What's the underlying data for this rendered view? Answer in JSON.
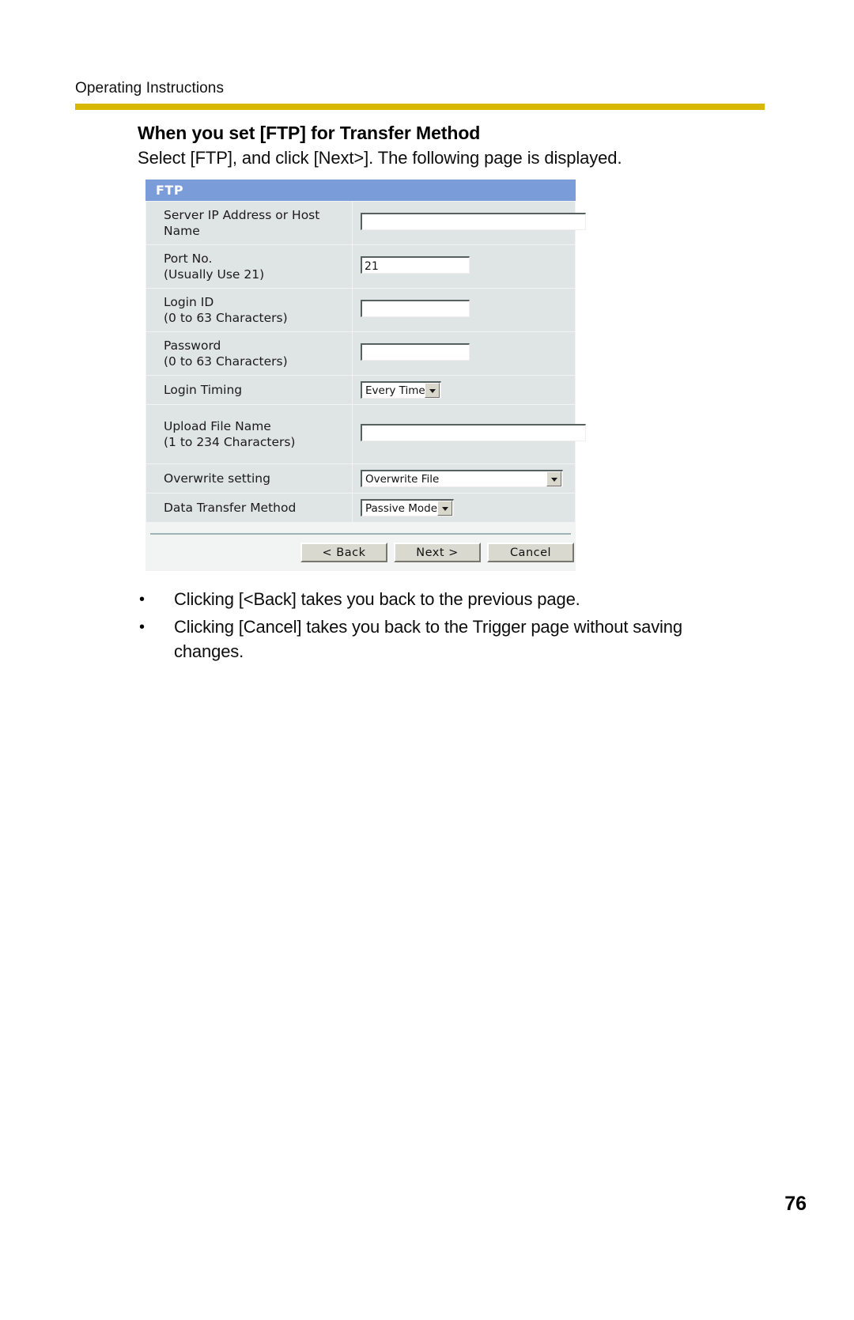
{
  "header": {
    "running_head": "Operating Instructions",
    "rule_color": "#d8b800"
  },
  "section": {
    "heading": "When you set [FTP] for Transfer Method",
    "lead": "Select [FTP], and click [Next>]. The following page is displayed."
  },
  "ftp_panel": {
    "title": "FTP",
    "title_bg": "#7a9cd8",
    "rows": [
      {
        "label": "Server IP Address or Host",
        "label_line2": "Name",
        "control": "text",
        "value": ""
      },
      {
        "label": "Port No.",
        "label_line2": "(Usually Use 21)",
        "control": "text",
        "value": "21"
      },
      {
        "label": "Login ID",
        "label_line2": "(0 to 63 Characters)",
        "control": "text",
        "value": ""
      },
      {
        "label": "Password",
        "label_line2": "(0 to 63 Characters)",
        "control": "text",
        "value": ""
      },
      {
        "label": "Login Timing",
        "label_line2": "",
        "control": "select",
        "value": "Every Time"
      },
      {
        "label": "Upload File Name",
        "label_line2": "(1 to 234 Characters)",
        "control": "text",
        "value": ""
      },
      {
        "label": "Overwrite setting",
        "label_line2": "",
        "control": "select",
        "value": "Overwrite File"
      },
      {
        "label": "Data Transfer Method",
        "label_line2": "",
        "control": "select",
        "value": "Passive Mode"
      }
    ],
    "buttons": {
      "back": "< Back",
      "next": "Next >",
      "cancel": "Cancel"
    }
  },
  "notes": {
    "bullet_glyph": "•",
    "items": [
      "Clicking [<Back] takes you back to the previous page.",
      "Clicking [Cancel] takes you back to the Trigger page without saving changes."
    ]
  },
  "footer": {
    "page_number": "76"
  }
}
